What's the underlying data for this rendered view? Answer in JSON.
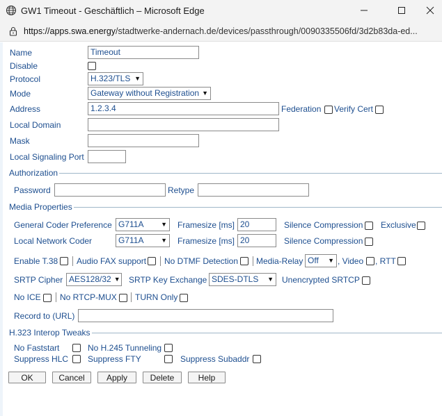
{
  "window": {
    "title": "GW1 Timeout - Geschäftlich – Microsoft Edge",
    "url_host": "https://apps.swa.energy",
    "url_path": "/stadtwerke-andernach.de/devices/passthrough/0090335506fd/3d2b83da-ed...",
    "icons": [
      "globe-icon",
      "minimize-icon",
      "maximize-icon",
      "close-icon",
      "lock-icon"
    ]
  },
  "form": {
    "name_label": "Name",
    "name_value": "Timeout",
    "disable_label": "Disable",
    "protocol_label": "Protocol",
    "protocol_value": "H.323/TLS",
    "mode_label": "Mode",
    "mode_value": "Gateway without Registration",
    "address_label": "Address",
    "address_value": "1.2.3.4",
    "federation_label": "Federation",
    "verify_cert_label": "Verify Cert",
    "local_domain_label": "Local Domain",
    "mask_label": "Mask",
    "local_signaling_port_label": "Local Signaling Port"
  },
  "authorization": {
    "legend": "Authorization",
    "password_label": "Password",
    "retype_label": "Retype"
  },
  "media": {
    "legend": "Media Properties",
    "general_coder_label": "General Coder Preference",
    "general_coder_value": "G711A",
    "framesize_label": "Framesize [ms]",
    "general_framesize_value": "20",
    "silence_compression_label": "Silence Compression",
    "exclusive_label": "Exclusive",
    "local_network_coder_label": "Local Network Coder",
    "local_network_coder_value": "G711A",
    "local_framesize_value": "20",
    "enable_t38_label": "Enable T.38",
    "audio_fax_label": "Audio FAX support",
    "no_dtmf_label": "No DTMF Detection",
    "media_relay_label": "Media-Relay",
    "media_relay_value": "Off",
    "video_label": ", Video",
    "rtt_label": ", RTT",
    "srtp_cipher_label": "SRTP Cipher",
    "srtp_cipher_value": "AES128/32",
    "srtp_key_exchange_label": "SRTP Key Exchange",
    "srtp_key_exchange_value": "SDES-DTLS",
    "unencrypted_srtcp_label": "Unencrypted SRTCP",
    "no_ice_label": "No ICE",
    "no_rtcp_mux_label": "No RTCP-MUX",
    "turn_only_label": "TURN Only",
    "record_to_label": "Record to (URL)"
  },
  "h323": {
    "legend": "H.323 Interop Tweaks",
    "no_faststart_label": "No Faststart",
    "no_h245_label": "No H.245 Tunneling",
    "suppress_hlc_label": "Suppress HLC",
    "suppress_fty_label": "Suppress FTY",
    "suppress_subaddr_label": "Suppress Subaddr"
  },
  "buttons": {
    "ok": "OK",
    "cancel": "Cancel",
    "apply": "Apply",
    "delete": "Delete",
    "help": "Help"
  }
}
